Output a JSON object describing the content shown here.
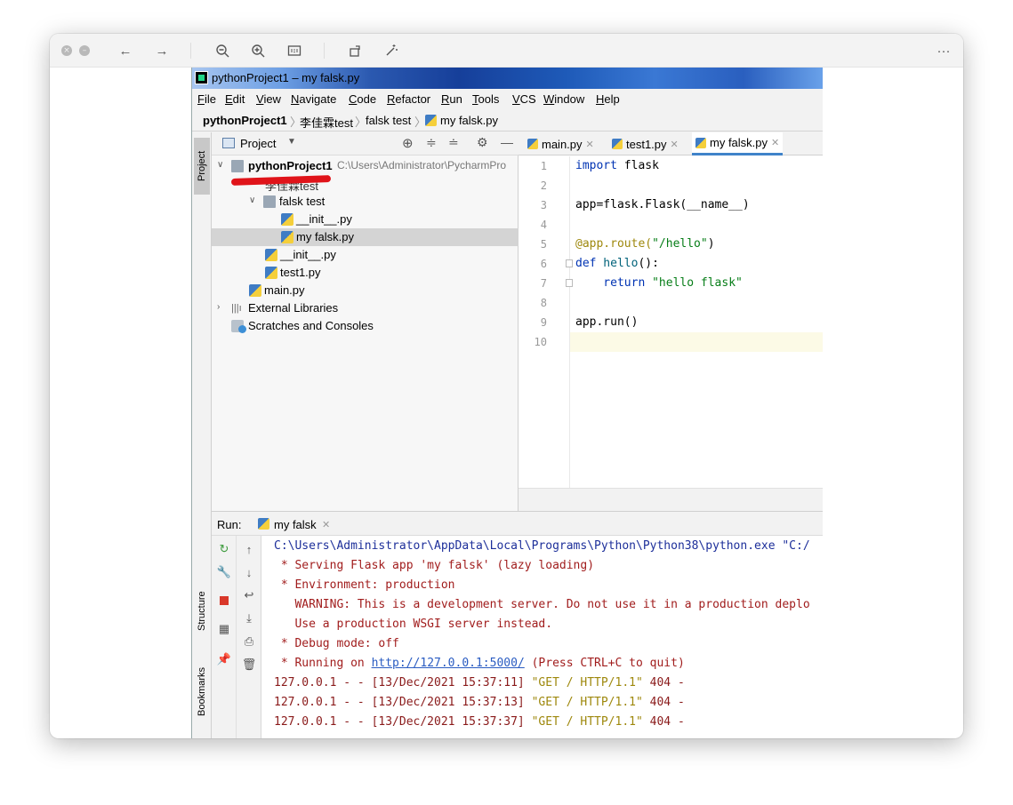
{
  "ide": {
    "window_title": "pythonProject1 – my falsk.py",
    "menu": [
      "File",
      "Edit",
      "View",
      "Navigate",
      "Code",
      "Refactor",
      "Run",
      "Tools",
      "VCS",
      "Window",
      "Help"
    ],
    "breadcrumb": [
      "pythonProject1",
      "李佳霖test",
      "falsk test",
      "my falsk.py"
    ],
    "left_strip": {
      "project": "Project",
      "structure": "Structure",
      "bookmarks": "Bookmarks"
    },
    "project_panel": {
      "title": "Project",
      "tree": [
        {
          "label": "pythonProject1",
          "path": "C:\\Users\\Administrator\\PycharmPro"
        },
        {
          "label": "李佳霖test"
        },
        {
          "label": "falsk test"
        },
        {
          "label": "__init__.py"
        },
        {
          "label": "my falsk.py",
          "selected": true
        },
        {
          "label": "__init__.py"
        },
        {
          "label": "test1.py"
        },
        {
          "label": "main.py"
        },
        {
          "label": "External Libraries"
        },
        {
          "label": "Scratches and Consoles"
        }
      ]
    },
    "editor": {
      "tabs": [
        {
          "label": "main.py"
        },
        {
          "label": "test1.py"
        },
        {
          "label": "my falsk.py",
          "active": true
        }
      ],
      "line_numbers": [
        "1",
        "2",
        "3",
        "4",
        "5",
        "6",
        "7",
        "8",
        "9",
        "10"
      ],
      "code": {
        "l1_kw": "import",
        "l1_rest": " flask",
        "l3": "app=flask.Flask(__name__)",
        "l5_dec": "@app.route(",
        "l5_str": "\"/hello\"",
        "l5_end": ")",
        "l6_kw": "def",
        "l6_fn": " hello",
        "l6_end": "():",
        "l7_kw": "    return",
        "l7_str": " \"hello flask\"",
        "l9": "app.run()"
      }
    },
    "run": {
      "label": "Run:",
      "tab": "my falsk",
      "console": {
        "cmd": "C:\\Users\\Administrator\\AppData\\Local\\Programs\\Python\\Python38\\python.exe \"C:/",
        "serving": " * Serving Flask app 'my falsk' (lazy loading)",
        "environment": " * Environment: production",
        "warning": "   WARNING: This is a development server. Do not use it in a production deplo",
        "wsgi": "   Use a production WSGI server instead.",
        "debug": " * Debug mode: off",
        "running_pre": " * Running on ",
        "running_url": "http://127.0.0.1:5000/",
        "running_post": " (Press CTRL+C to quit)",
        "log_prefix": [
          "127.0.0.1 - - [13/Dec/2021 15:37:11] ",
          "127.0.0.1 - - [13/Dec/2021 15:37:13] ",
          "127.0.0.1 - - [13/Dec/2021 15:37:37] "
        ],
        "log_request": "\"GET / HTTP/1.1\"",
        "log_status": " 404 -"
      }
    }
  }
}
